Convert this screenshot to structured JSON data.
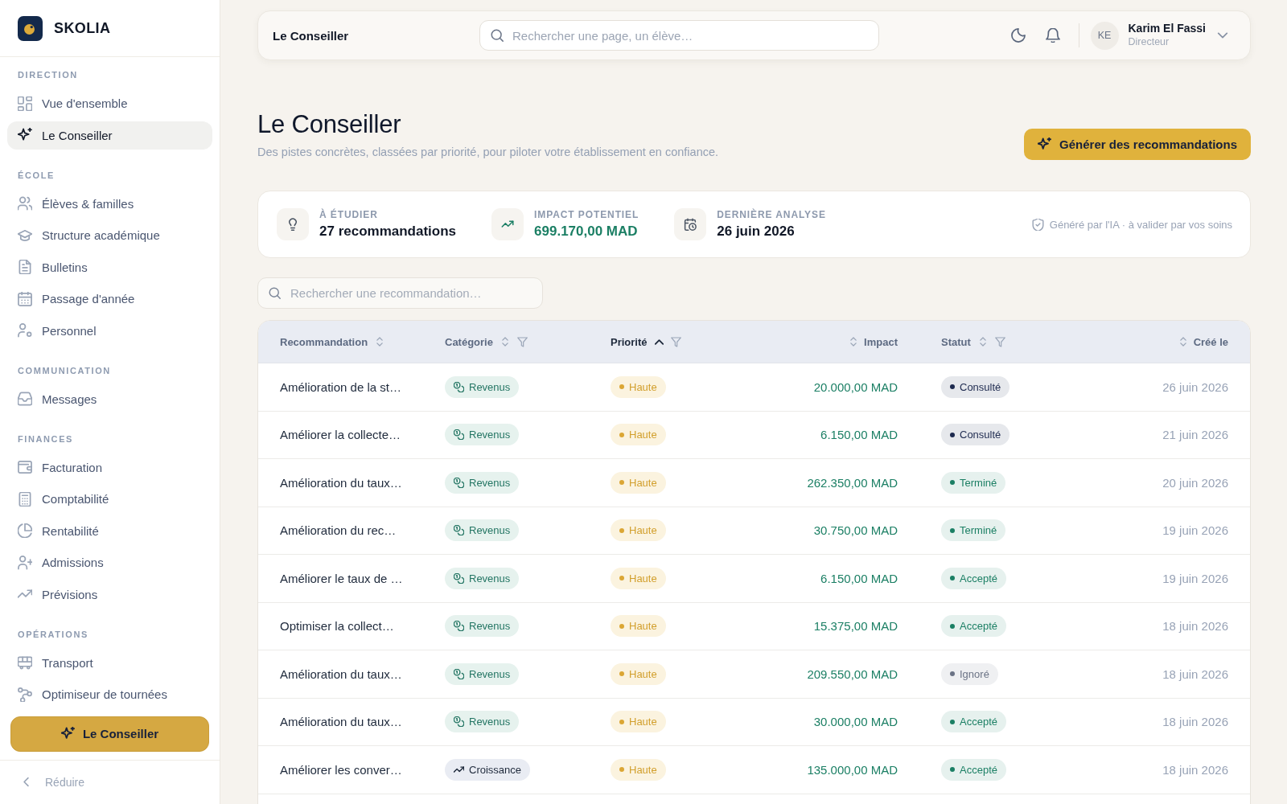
{
  "sidebar": {
    "brand": "SKOLIA",
    "sections": [
      {
        "title": "DIRECTION",
        "items": [
          {
            "label": "Vue d'ensemble",
            "selected": false
          },
          {
            "label": "Le Conseiller",
            "selected": true
          }
        ]
      },
      {
        "title": "ÉCOLE",
        "items": [
          {
            "label": "Élèves & familles",
            "selected": false
          },
          {
            "label": "Structure académique",
            "selected": false
          },
          {
            "label": "Bulletins",
            "selected": false
          },
          {
            "label": "Passage d'année",
            "selected": false
          },
          {
            "label": "Personnel",
            "selected": false
          }
        ]
      },
      {
        "title": "COMMUNICATION",
        "items": [
          {
            "label": "Messages",
            "selected": false
          }
        ]
      },
      {
        "title": "FINANCES",
        "items": [
          {
            "label": "Facturation",
            "selected": false
          },
          {
            "label": "Comptabilité",
            "selected": false
          },
          {
            "label": "Rentabilité",
            "selected": false
          },
          {
            "label": "Admissions",
            "selected": false
          },
          {
            "label": "Prévisions",
            "selected": false
          }
        ]
      },
      {
        "title": "OPÉRATIONS",
        "items": [
          {
            "label": "Transport",
            "selected": false
          },
          {
            "label": "Optimiseur de tournées",
            "selected": false
          }
        ]
      }
    ],
    "cta": "Le Conseiller",
    "collapse": "Réduire"
  },
  "topbar": {
    "title": "Le Conseiller",
    "search": {
      "placeholder": "Rechercher une page, un élève…"
    },
    "user": {
      "initials": "KE",
      "name": "Karim El Fassi",
      "role": "Directeur"
    }
  },
  "header": {
    "title": "Le Conseiller",
    "subtitle": "Des pistes concrètes, classées par priorité, pour piloter votre établissement en confiance.",
    "action": "Générer des recommandations"
  },
  "stats": {
    "items": [
      {
        "kind": "count",
        "label": "À ÉTUDIER",
        "value": "27 recommandations"
      },
      {
        "kind": "amount",
        "label": "IMPACT POTENTIEL",
        "value": "699.170,00 MAD"
      },
      {
        "kind": "date",
        "label": "DERNIÈRE ANALYSE",
        "value": "26 juin 2026"
      }
    ],
    "note": "Généré par l'IA · à valider par vos soins"
  },
  "filter_search": {
    "placeholder": "Rechercher une recommandation…"
  },
  "table": {
    "columns": [
      {
        "label": "Recommandation",
        "sorted": false,
        "filter": false
      },
      {
        "label": "Catégorie",
        "sorted": false,
        "filter": true
      },
      {
        "label": "Priorité",
        "sorted": true,
        "filter": true
      },
      {
        "label": "Impact",
        "sorted": false,
        "filter": false
      },
      {
        "label": "Statut",
        "sorted": false,
        "filter": true
      },
      {
        "label": "Créé le",
        "sorted": false,
        "filter": false
      }
    ],
    "rows": [
      {
        "title": "Amélioration de la st…",
        "category": {
          "label": "Revenus",
          "kind": "revenus"
        },
        "priority": "Haute",
        "impact": "20.000,00 MAD",
        "status": {
          "label": "Consulté",
          "color": "#1e2a4f"
        },
        "created": "26 juin 2026"
      },
      {
        "title": "Améliorer la collecte…",
        "category": {
          "label": "Revenus",
          "kind": "revenus"
        },
        "priority": "Haute",
        "impact": "6.150,00 MAD",
        "status": {
          "label": "Consulté",
          "color": "#1e2a4f"
        },
        "created": "21 juin 2026"
      },
      {
        "title": "Amélioration du taux…",
        "category": {
          "label": "Revenus",
          "kind": "revenus"
        },
        "priority": "Haute",
        "impact": "262.350,00 MAD",
        "status": {
          "label": "Terminé",
          "color": "#1b7f64"
        },
        "created": "20 juin 2026"
      },
      {
        "title": "Amélioration du rec…",
        "category": {
          "label": "Revenus",
          "kind": "revenus"
        },
        "priority": "Haute",
        "impact": "30.750,00 MAD",
        "status": {
          "label": "Terminé",
          "color": "#1b7f64"
        },
        "created": "19 juin 2026"
      },
      {
        "title": "Améliorer le taux de …",
        "category": {
          "label": "Revenus",
          "kind": "revenus"
        },
        "priority": "Haute",
        "impact": "6.150,00 MAD",
        "status": {
          "label": "Accepté",
          "color": "#1b7f64"
        },
        "created": "19 juin 2026"
      },
      {
        "title": "Optimiser la collect…",
        "category": {
          "label": "Revenus",
          "kind": "revenus"
        },
        "priority": "Haute",
        "impact": "15.375,00 MAD",
        "status": {
          "label": "Accepté",
          "color": "#1b7f64"
        },
        "created": "18 juin 2026"
      },
      {
        "title": "Amélioration du taux…",
        "category": {
          "label": "Revenus",
          "kind": "revenus"
        },
        "priority": "Haute",
        "impact": "209.550,00 MAD",
        "status": {
          "label": "Ignoré",
          "color": "#6b7385"
        },
        "created": "18 juin 2026"
      },
      {
        "title": "Amélioration du taux…",
        "category": {
          "label": "Revenus",
          "kind": "revenus"
        },
        "priority": "Haute",
        "impact": "30.000,00 MAD",
        "status": {
          "label": "Accepté",
          "color": "#1b7f64"
        },
        "created": "18 juin 2026"
      },
      {
        "title": "Améliorer les conver…",
        "category": {
          "label": "Croissance",
          "kind": "croissance"
        },
        "priority": "Haute",
        "impact": "135.000,00 MAD",
        "status": {
          "label": "Accepté",
          "color": "#1b7f64"
        },
        "created": "18 juin 2026"
      }
    ]
  }
}
